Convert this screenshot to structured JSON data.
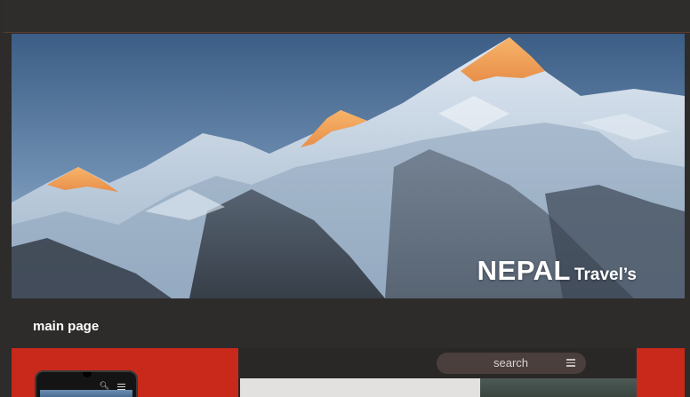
{
  "hero": {
    "title_main": "NEPAL",
    "title_sub": "Travel’s"
  },
  "section": {
    "label": "main page"
  },
  "preview": {
    "search_label": "search",
    "icons": [
      "menu-icon",
      "search-icon"
    ]
  },
  "colors": {
    "background": "#2e2c2b",
    "accent_red": "#c8291a",
    "search_pill": "#4a3f3c"
  }
}
